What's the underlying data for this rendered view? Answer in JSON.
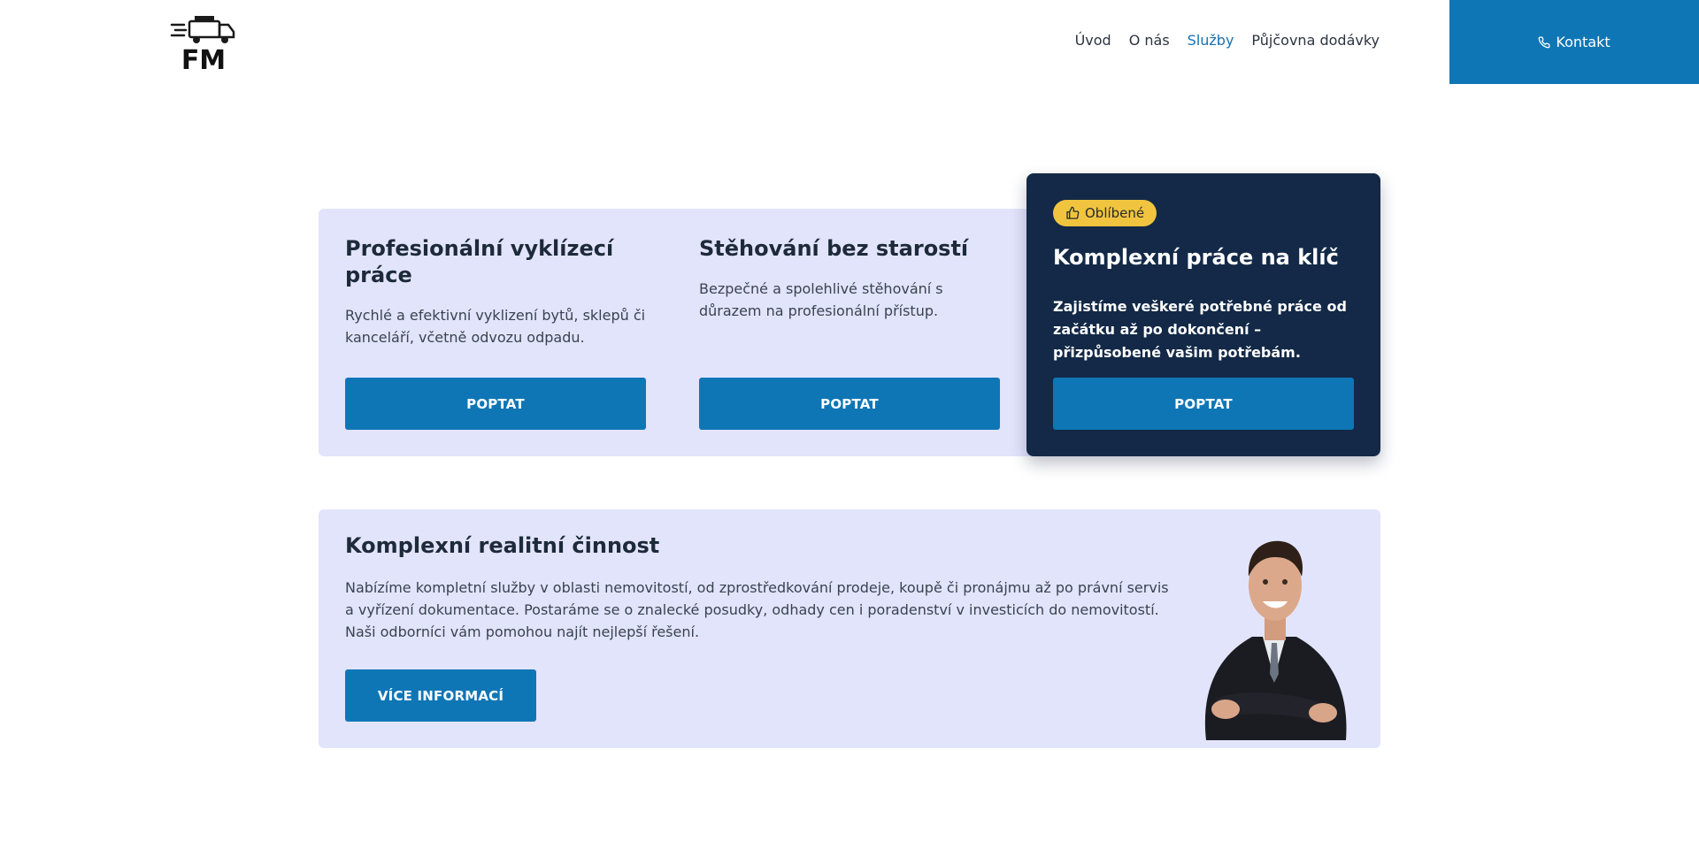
{
  "header": {
    "logo_text": "FM",
    "nav": [
      {
        "label": "Úvod",
        "active": false
      },
      {
        "label": "O nás",
        "active": false
      },
      {
        "label": "Služby",
        "active": true
      },
      {
        "label": "Půjčovna dodávky",
        "active": false
      }
    ],
    "contact_label": "Kontakt",
    "contact_icon": "phone-icon"
  },
  "services": [
    {
      "title": "Profesionální vyklízecí práce",
      "description": "Rychlé a efektivní vyklizení bytů, sklepů či kanceláří, včetně odvozu odpadu.",
      "button": "POPTAT"
    },
    {
      "title": "Stěhování bez starostí",
      "description": "Bezpečné a spolehlivé stěhování s důrazem na profesionální přístup.",
      "button": "POPTAT"
    },
    {
      "badge": "Oblíbené",
      "badge_icon": "thumbs-up-icon",
      "title": "Komplexní práce na klíč",
      "description": "Zajistíme veškeré potřebné práce od začátku až po dokončení – přizpůsobené vašim potřebám.",
      "button": "POPTAT"
    }
  ],
  "realty": {
    "title": "Komplexní realitní činnost",
    "description": "Nabízíme kompletní služby v oblasti nemovitostí, od zprostředkování prodeje, koupě či pronájmu až po právní servis a vyřízení dokumentace. Postaráme se o znalecké posudky, odhady cen i poradenství v investicích do nemovitostí. Naši odborníci vám pomohou najít nejlepší řešení.",
    "button": "VÍCE INFORMACÍ",
    "image": "businessman-photo"
  },
  "colors": {
    "primary": "#0f76b6",
    "dark_card": "#132947",
    "band_bg": "#e2e4fb",
    "badge": "#f1c43f",
    "nav_active": "#1573b4"
  }
}
